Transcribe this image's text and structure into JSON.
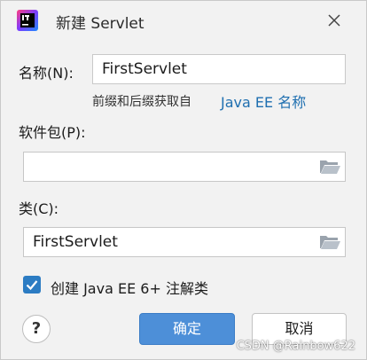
{
  "dialog": {
    "title": "新建 Servlet",
    "name_label": "名称(N):",
    "name_value": "FirstServlet",
    "hint_text": "前缀和后缀获取自",
    "hint_link": "Java EE 名称",
    "package_label": "软件包(P):",
    "package_value": "",
    "class_label": "类(C):",
    "class_value": "FirstServlet",
    "checkbox_label": "创建 Java EE 6+ 注解类",
    "checkbox_checked": true,
    "help_label": "?",
    "ok_label": "确定",
    "cancel_label": "取消"
  },
  "watermark": "CSDN @Rainbow622",
  "colors": {
    "accent": "#4d8fd8",
    "link": "#1f6fb0",
    "checkbox": "#2c7cc3"
  },
  "icons": {
    "app": "intellij-idea-icon",
    "close": "close-icon",
    "folder": "folder-open-icon",
    "check": "check-icon"
  }
}
